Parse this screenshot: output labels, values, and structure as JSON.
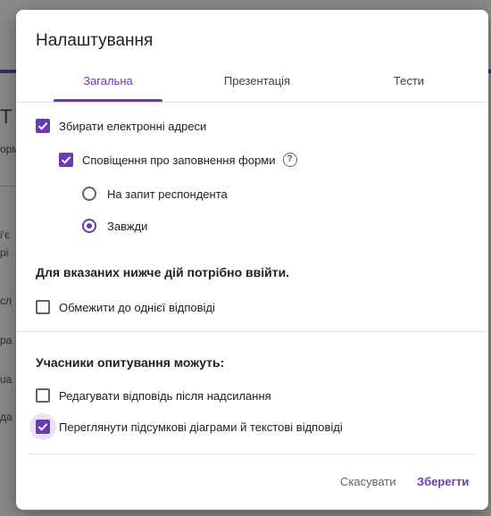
{
  "background": {
    "fragments": [
      "T",
      "орм",
      "і'є",
      "рі",
      "сл",
      "ра",
      "ua",
      "да"
    ]
  },
  "dialog": {
    "title": "Налаштування",
    "tabs": [
      {
        "label": "Загальна",
        "active": true
      },
      {
        "label": "Презентація",
        "active": false
      },
      {
        "label": "Тести",
        "active": false
      }
    ],
    "collect_emails": {
      "label": "Збирати електронні адреси",
      "checked": true
    },
    "form_notification": {
      "label": "Сповіщення про заповнення форми",
      "checked": true,
      "help_glyph": "?"
    },
    "radio_options": [
      {
        "label": "На запит респондента",
        "selected": false
      },
      {
        "label": "Завжди",
        "selected": true
      }
    ],
    "signin_section": {
      "title": "Для вказаних нижче дій потрібно ввійти."
    },
    "limit_one_response": {
      "label": "Обмежити до однієї відповіді",
      "checked": false
    },
    "respondents_section": {
      "title": "Учасники опитування можуть:"
    },
    "edit_after_submit": {
      "label": "Редагувати відповідь після надсилання",
      "checked": false
    },
    "see_summary": {
      "label": "Переглянути підсумкові діаграми й текстові відповіді",
      "checked": true
    },
    "buttons": {
      "cancel": "Скасувати",
      "save": "Зберегти"
    }
  },
  "colors": {
    "accent": "#673ab7",
    "text": "#202124",
    "muted": "#5f6368"
  }
}
